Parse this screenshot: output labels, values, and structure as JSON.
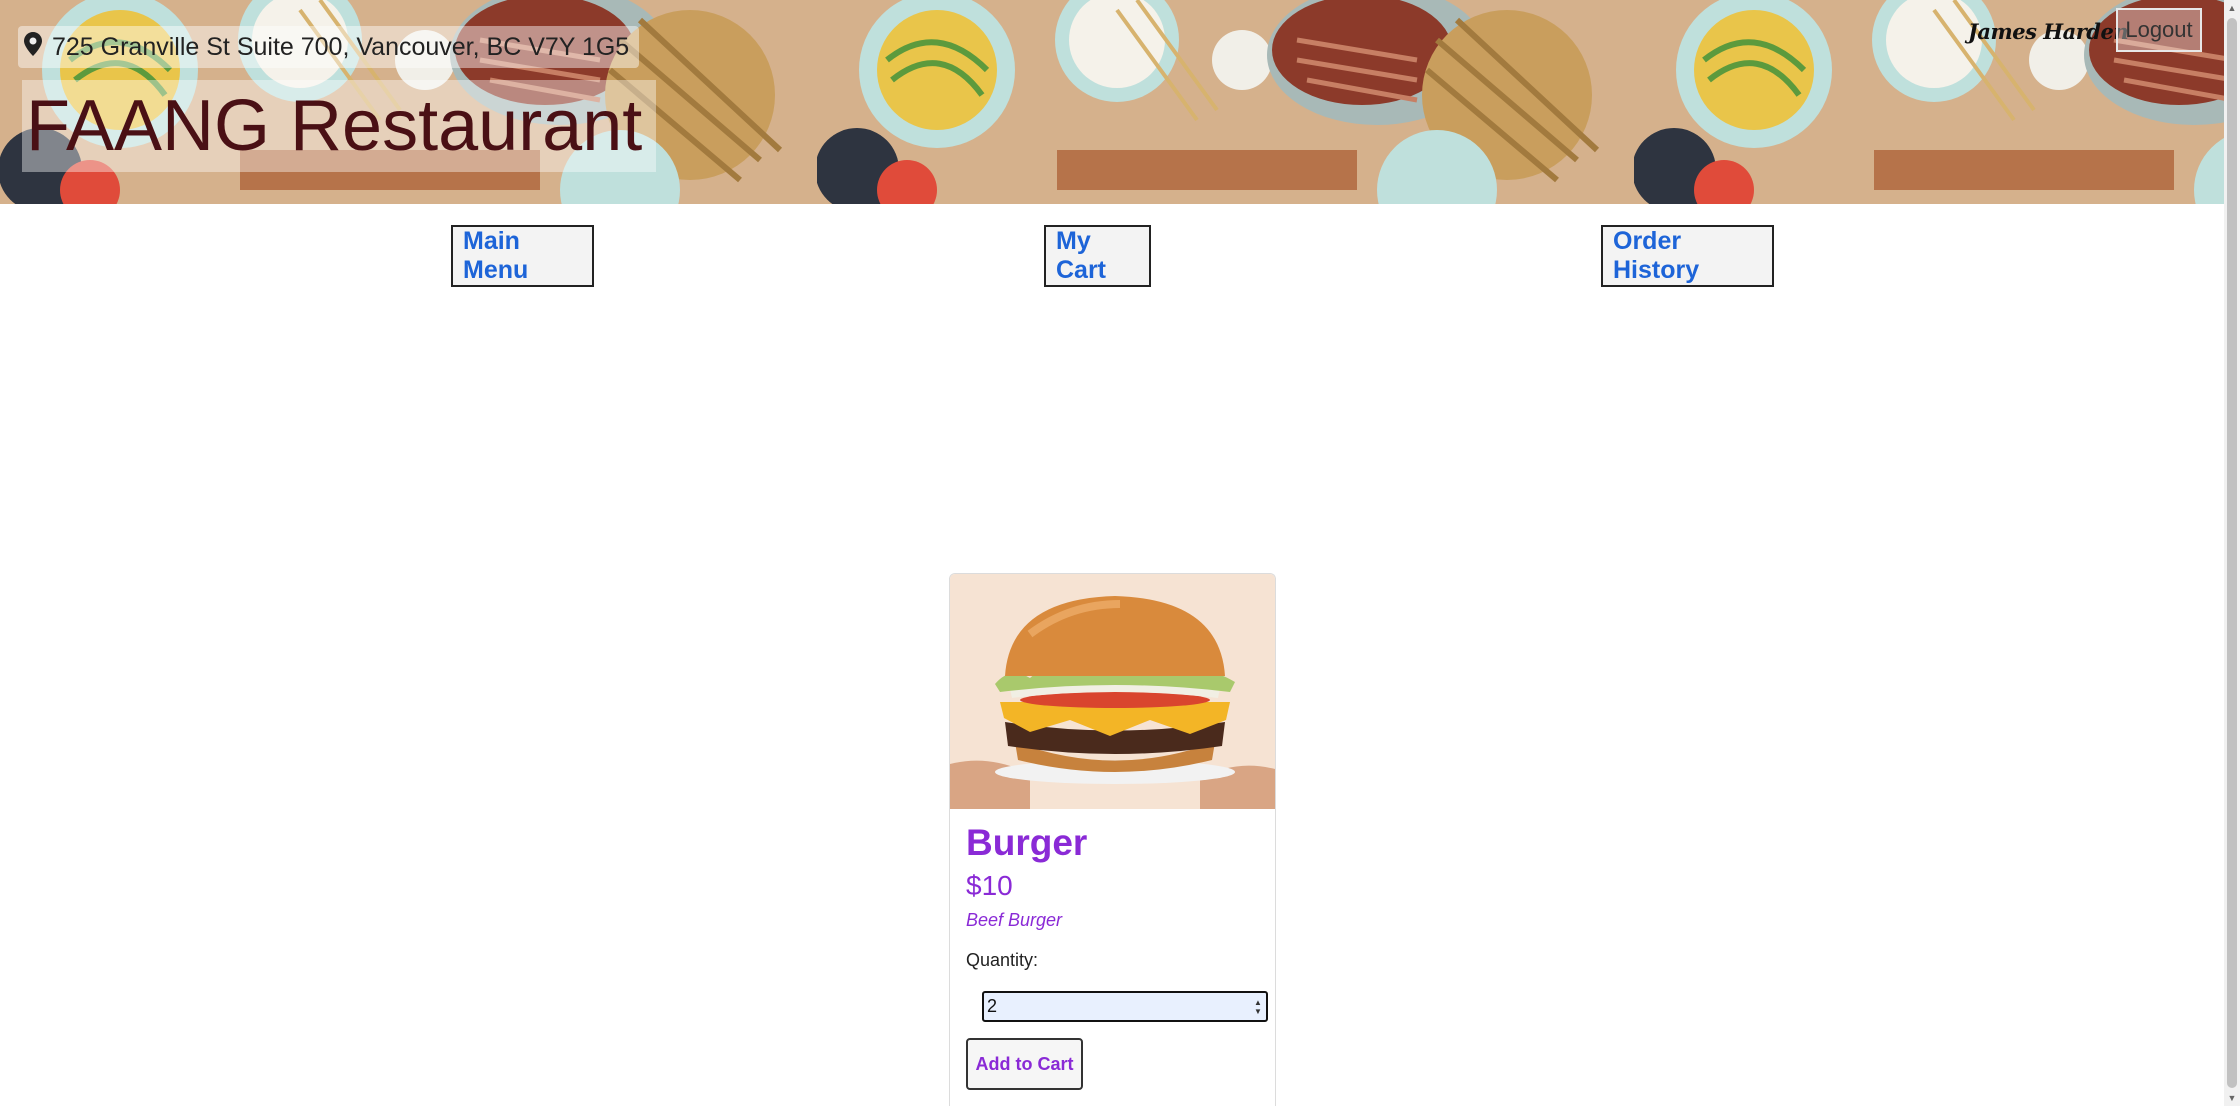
{
  "header": {
    "address": "725 Granville St Suite 700, Vancouver, BC V7Y 1G5",
    "title": "FAANG Restaurant",
    "user_name": "James Harden",
    "logout_label": "Logout",
    "address_icon": "map-pin-icon"
  },
  "nav": {
    "main_menu": "Main Menu",
    "my_cart": "My Cart",
    "order_history": "Order History"
  },
  "product": {
    "name": "Burger",
    "price": "$10",
    "description": "Beef Burger",
    "quantity_label": "Quantity:",
    "quantity_value": "2",
    "add_to_cart": "Add to Cart"
  },
  "colors": {
    "title": "#4a1015",
    "nav_text": "#1d64d8",
    "product_accent": "#8a2ad6",
    "qty_input_bg": "#e8f0fe"
  }
}
